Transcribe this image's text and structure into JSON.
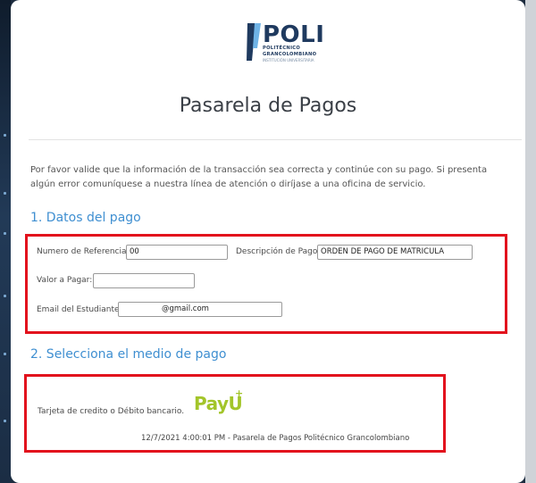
{
  "logo": {
    "wordmark": "POLI",
    "line1": "POLITÉCNICO",
    "line2": "GRANCOLOMBIANO",
    "line3": "INSTITUCIÓN UNIVERSITARIA"
  },
  "header": {
    "title": "Pasarela de Pagos"
  },
  "intro": "Por favor valide que la información de la transacción sea correcta y continúe con su pago. Si presenta algún error comuníquese a nuestra línea de atención o diríjase a una oficina de servicio.",
  "section1": {
    "title": "1. Datos del pago",
    "ref_label": "Numero de Referencia:",
    "ref_value": "00",
    "desc_label": "Descripción de Pago:",
    "desc_value": "ORDEN DE PAGO DE MATRICULA",
    "amount_label": "Valor a Pagar:",
    "amount_value": "",
    "email_label": "Email del Estudiante:",
    "email_value": "@gmail.com"
  },
  "section2": {
    "title": "2. Selecciona el medio de pago",
    "method_label": "Tarjeta de credito o Débito bancario.",
    "payu_logo": "PayU"
  },
  "footer": "12/7/2021 4:00:01 PM - Pasarela de Pagos Politécnico Grancolombiano",
  "colors": {
    "accent": "#3f8fd1",
    "highlight": "#e2121d",
    "payu": "#a3c52a",
    "brand": "#1f3a5f"
  }
}
